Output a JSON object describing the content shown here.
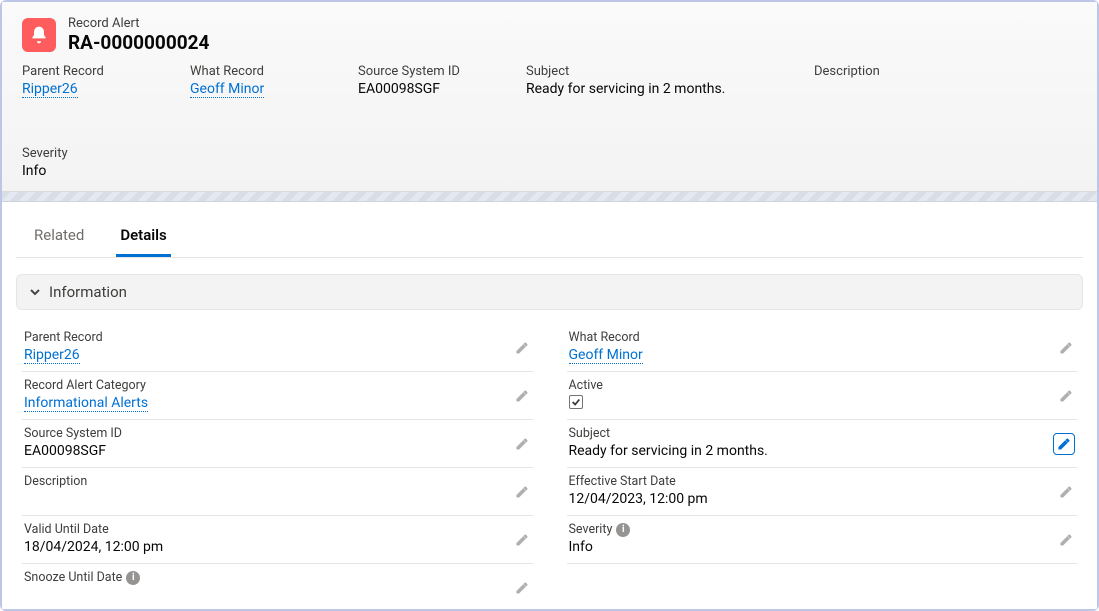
{
  "header": {
    "type_label": "Record Alert",
    "record_name": "RA-0000000024"
  },
  "highlights": [
    {
      "label": "Parent Record",
      "value": "Ripper26",
      "is_link": true
    },
    {
      "label": "What Record",
      "value": "Geoff Minor",
      "is_link": true
    },
    {
      "label": "Source System ID",
      "value": "EA00098SGF",
      "is_link": false
    },
    {
      "label": "Subject",
      "value": "Ready for servicing in 2 months.",
      "is_link": false
    },
    {
      "label": "Description",
      "value": "",
      "is_link": false
    },
    {
      "label": "Severity",
      "value": "Info",
      "is_link": false
    }
  ],
  "tabs": [
    {
      "label": "Related",
      "active": false
    },
    {
      "label": "Details",
      "active": true
    }
  ],
  "section": {
    "title": "Information"
  },
  "fields": {
    "left": {
      "parent_record": {
        "label": "Parent Record",
        "value": "Ripper26"
      },
      "record_alert_category": {
        "label": "Record Alert Category",
        "value": "Informational Alerts"
      },
      "source_system_id": {
        "label": "Source System ID",
        "value": "EA00098SGF"
      },
      "description": {
        "label": "Description",
        "value": ""
      },
      "valid_until_date": {
        "label": "Valid Until Date",
        "value": "18/04/2024, 12:00 pm"
      },
      "snooze_until_date": {
        "label": "Snooze Until Date",
        "value": ""
      }
    },
    "right": {
      "what_record": {
        "label": "What Record",
        "value": "Geoff Minor"
      },
      "active": {
        "label": "Active",
        "checked": true
      },
      "subject": {
        "label": "Subject",
        "value": "Ready for servicing in 2 months."
      },
      "effective_start_date": {
        "label": "Effective Start Date",
        "value": "12/04/2023, 12:00 pm"
      },
      "severity": {
        "label": "Severity",
        "value": "Info"
      }
    }
  }
}
